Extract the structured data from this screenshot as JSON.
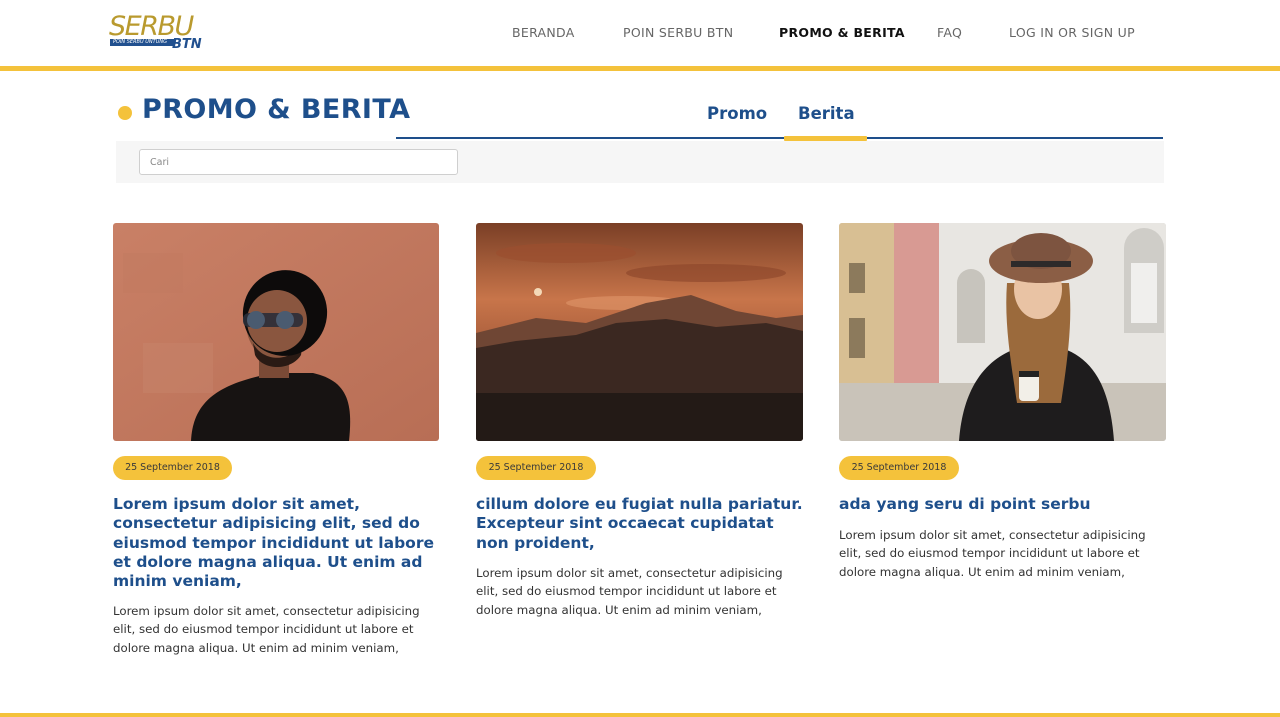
{
  "brand": {
    "logo_word": "SERBU",
    "logo_tagline": "POIN SERBU UNTUNG",
    "logo_sub": "BTN",
    "accent_color": "#f4c23b",
    "primary_color": "#1e4f8b"
  },
  "nav": {
    "items": [
      {
        "label": "BERANDA",
        "active": false
      },
      {
        "label": "POIN SERBU BTN",
        "active": false
      },
      {
        "label": "PROMO & BERITA",
        "active": true
      },
      {
        "label": "FAQ",
        "active": false
      },
      {
        "label": "LOG IN OR SIGN UP",
        "active": false
      }
    ]
  },
  "page": {
    "title": "PROMO & BERITA",
    "tabs": [
      {
        "label": "Promo",
        "active": false
      },
      {
        "label": "Berita",
        "active": true
      }
    ],
    "search": {
      "placeholder": "Cari",
      "value": ""
    }
  },
  "articles": [
    {
      "image": "photo-man-hat",
      "date": "25 September 2018",
      "title": "Lorem ipsum dolor sit amet, consectetur adipisicing elit, sed do eiusmod tempor incididunt ut labore et dolore magna aliqua. Ut enim ad minim veniam,",
      "excerpt": "Lorem ipsum dolor sit amet, consectetur adipisicing elit, sed do eiusmod tempor incididunt ut labore et dolore magna aliqua. Ut enim ad minim veniam,"
    },
    {
      "image": "photo-mountain-sunset",
      "date": "25 September 2018",
      "title": "cillum dolore eu fugiat nulla pariatur. Excepteur sint occaecat cupidatat non proident,",
      "excerpt": "Lorem ipsum dolor sit amet, consectetur adipisicing elit, sed do eiusmod tempor incididunt ut labore et dolore magna aliqua. Ut enim ad minim veniam,"
    },
    {
      "image": "photo-woman-street",
      "date": "25 September 2018",
      "title": "ada yang seru di point serbu",
      "excerpt": "Lorem ipsum dolor sit amet, consectetur adipisicing elit, sed do eiusmod tempor incididunt ut labore et dolore magna aliqua. Ut enim ad minim veniam,"
    }
  ]
}
